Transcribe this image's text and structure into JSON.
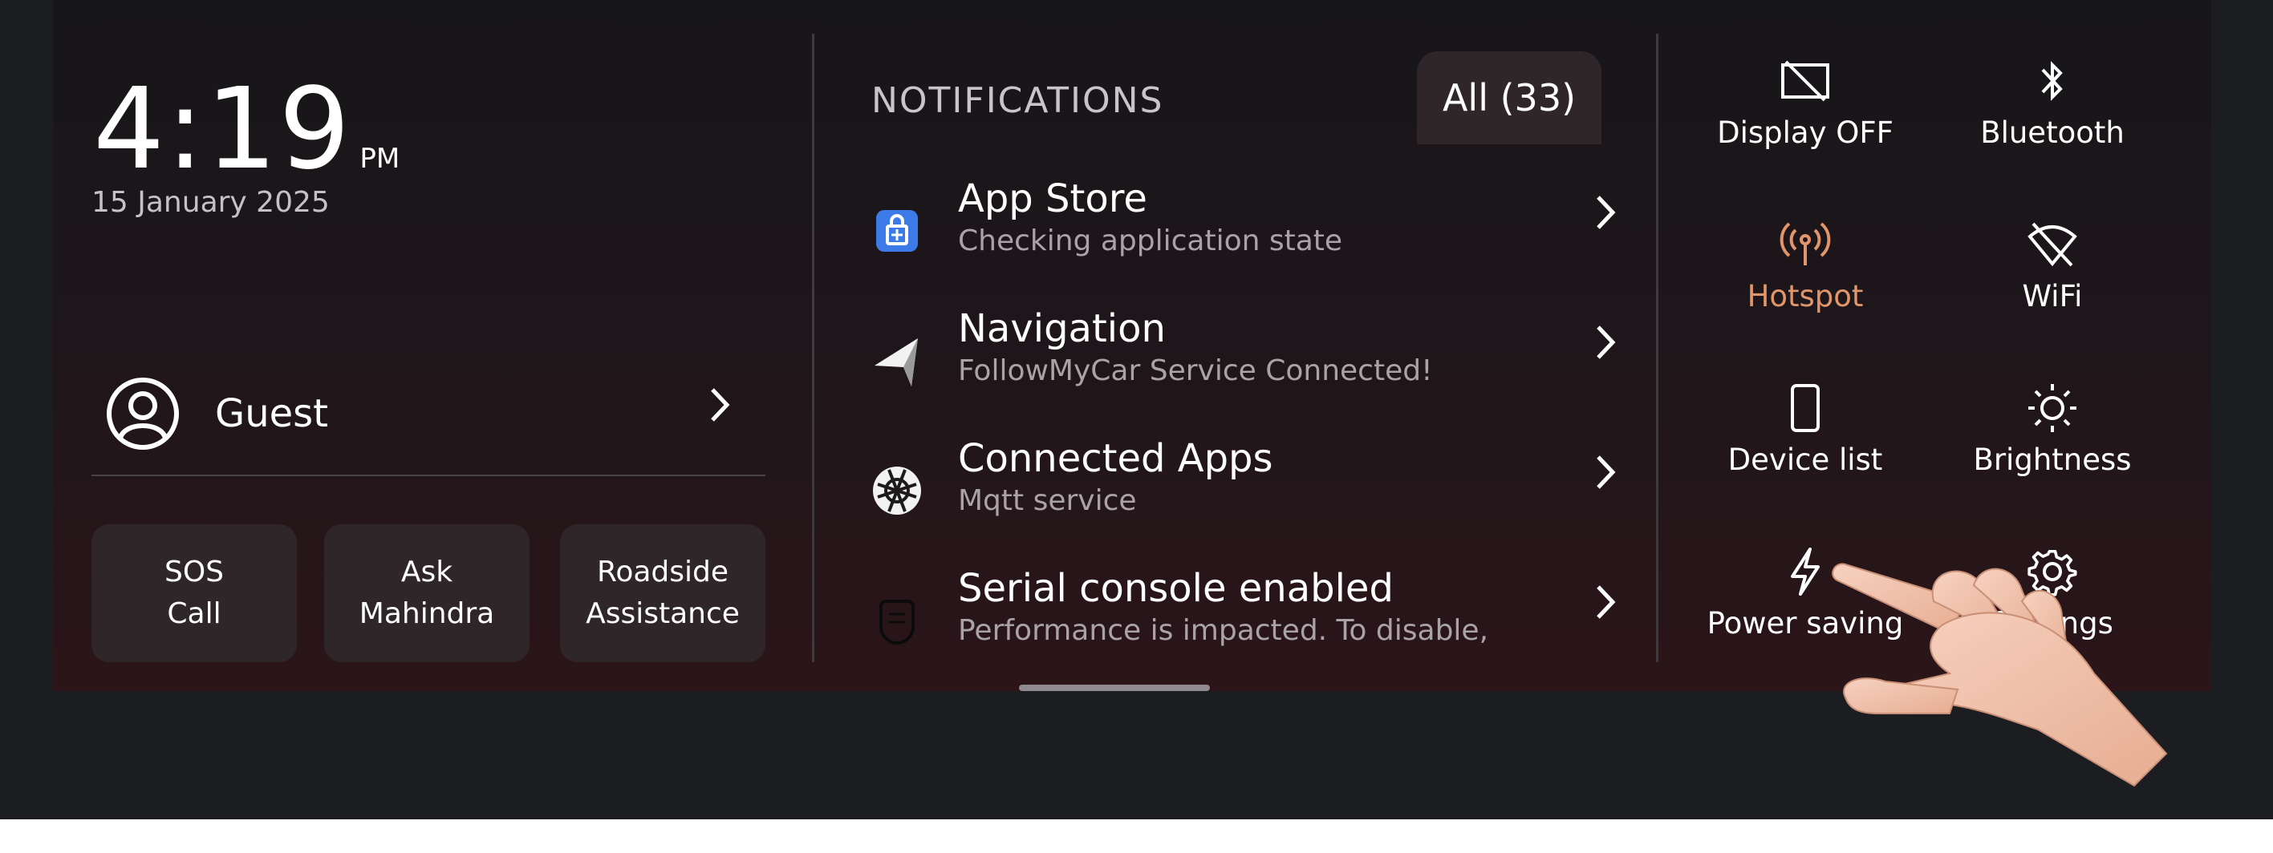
{
  "clock": {
    "time": "4:19",
    "ampm": "PM",
    "date": "15 January 2025"
  },
  "profile": {
    "name": "Guest"
  },
  "quick_actions": [
    {
      "label": "SOS\nCall"
    },
    {
      "label": "Ask\nMahindra"
    },
    {
      "label": "Roadside\nAssistance"
    }
  ],
  "notifications": {
    "title": "NOTIFICATIONS",
    "filter_label": "All (33)",
    "items": [
      {
        "title": "App Store",
        "subtitle": "Checking application state",
        "icon": "app-store-icon"
      },
      {
        "title": "Navigation",
        "subtitle": "FollowMyCar Service Connected!",
        "icon": "navigation-arrow-icon"
      },
      {
        "title": "Connected Apps",
        "subtitle": "Mqtt service",
        "icon": "connected-apps-icon"
      },
      {
        "title": "Serial console enabled",
        "subtitle": "Performance is impacted. To disable,",
        "icon": "serial-console-icon"
      }
    ]
  },
  "quick_settings": [
    {
      "label": "Display OFF",
      "icon": "display-off-icon",
      "active": false
    },
    {
      "label": "Bluetooth",
      "icon": "bluetooth-icon",
      "active": false
    },
    {
      "label": "Hotspot",
      "icon": "hotspot-icon",
      "active": true
    },
    {
      "label": "WiFi",
      "icon": "wifi-off-icon",
      "active": false
    },
    {
      "label": "Device list",
      "icon": "phone-icon",
      "active": false
    },
    {
      "label": "Brightness",
      "icon": "sun-icon",
      "active": false
    },
    {
      "label": "Power saving",
      "icon": "lightning-icon",
      "active": false
    },
    {
      "label": "Settings",
      "icon": "gear-icon",
      "active": false
    }
  ],
  "colors": {
    "active_accent": "#e0956a",
    "tile_bg": "#2f2629",
    "screen_bg": "#1d161a"
  }
}
